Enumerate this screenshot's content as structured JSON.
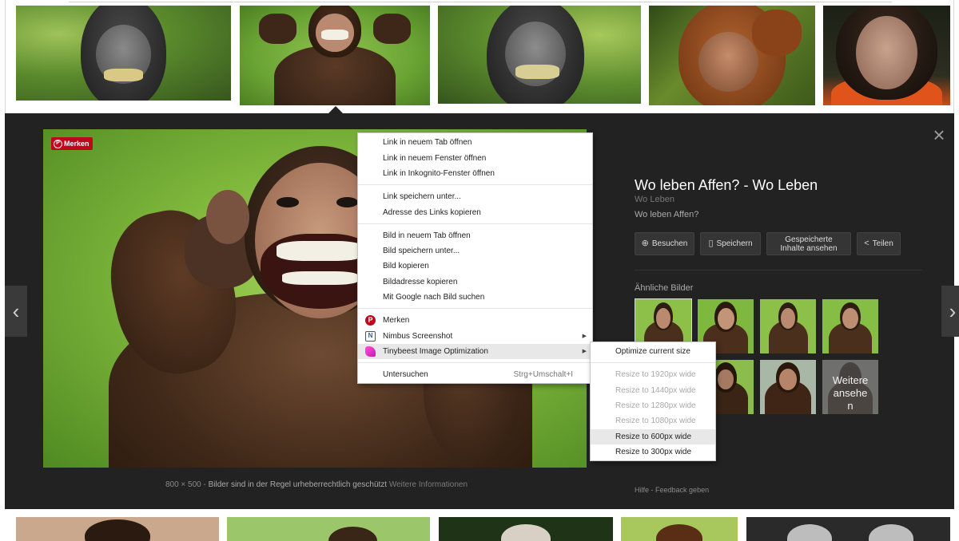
{
  "viewer": {
    "close_glyph": "×",
    "nav_prev_glyph": "‹",
    "nav_next_glyph": "›",
    "merken_badge": "Merken",
    "image_size": "800 × 500",
    "copyright_notice": "Bilder sind in der Regel urheberrechtlich geschützt",
    "more_info": "Weitere Informationen"
  },
  "info": {
    "title": "Wo leben Affen? - Wo Leben",
    "site": "Wo Leben",
    "description": "Wo leben Affen?",
    "buttons": {
      "visit": "Besuchen",
      "save": "Speichern",
      "saved_line1": "Gespeicherte",
      "saved_line2": "Inhalte ansehen",
      "share": "Teilen"
    },
    "similar_title": "Ähnliche Bilder",
    "more_similar_line1": "Weitere",
    "more_similar_line2": "ansehe",
    "more_similar_line3": "n",
    "help": "Hilfe",
    "feedback": "Feedback geben"
  },
  "context_menu": {
    "items": [
      "Link in neuem Tab öffnen",
      "Link in neuem Fenster öffnen",
      "Link in Inkognito-Fenster öffnen",
      "Link speichern unter...",
      "Adresse des Links kopieren",
      "Bild in neuem Tab öffnen",
      "Bild speichern unter...",
      "Bild kopieren",
      "Bildadresse kopieren",
      "Mit Google nach Bild suchen",
      "Merken",
      "Nimbus Screenshot",
      "Tinybeest Image Optimization",
      "Untersuchen"
    ],
    "inspect_shortcut": "Strg+Umschalt+I"
  },
  "sub_menu": {
    "items": [
      "Optimize current size",
      "Resize to 1920px wide",
      "Resize to 1440px wide",
      "Resize to 1280px wide",
      "Resize to 1080px wide",
      "Resize to 600px wide",
      "Resize to 300px wide"
    ]
  },
  "colors": {
    "viewer_bg": "#222222",
    "pinterest_red": "#bd081c",
    "menu_highlight": "#e8e8e8"
  }
}
